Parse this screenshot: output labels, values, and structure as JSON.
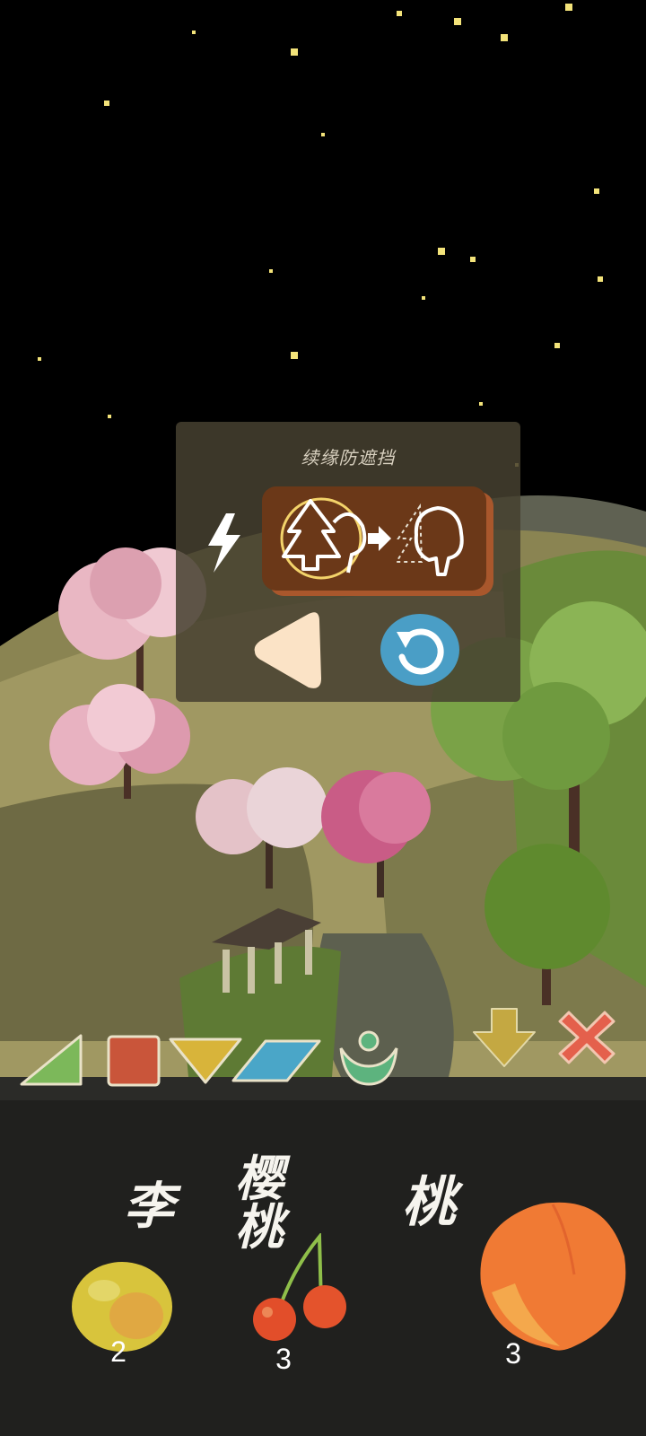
{
  "popup": {
    "title": "续缘防遮挡",
    "lightning_icon": "lightning-icon",
    "effect_icon": "tree-swap-icon",
    "back_icon": "triangle-left-icon",
    "reset_icon": "refresh-icon"
  },
  "tools": [
    {
      "name": "green-triangle-piece",
      "color": "#7cb85a"
    },
    {
      "name": "red-square-piece",
      "color": "#c9553a"
    },
    {
      "name": "yellow-triangle-down-piece",
      "color": "#d8b43a"
    },
    {
      "name": "blue-parallelogram-piece",
      "color": "#4aa6c8"
    },
    {
      "name": "green-person-piece",
      "color": "#5db37e"
    },
    {
      "name": "down-arrow-button",
      "color": "#c4a842"
    },
    {
      "name": "close-button",
      "color": "#e4604c"
    }
  ],
  "fruits": [
    {
      "name": "李",
      "count": "2"
    },
    {
      "name": "樱桃",
      "count": "3"
    },
    {
      "name": "桃",
      "count": "3"
    }
  ]
}
